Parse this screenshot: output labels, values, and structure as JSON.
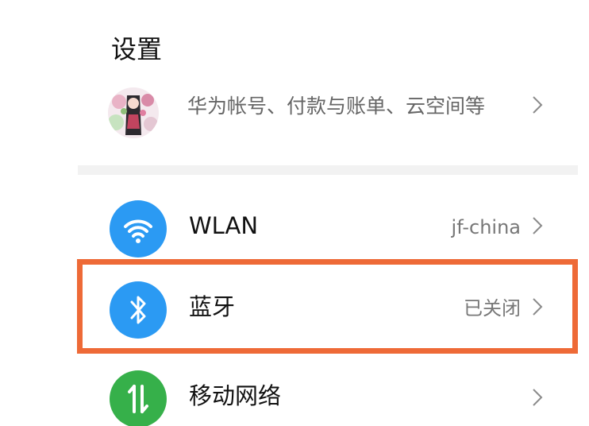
{
  "header": {
    "title": "设置"
  },
  "account": {
    "description": "华为帐号、付款与账单、云空间等",
    "chevron_icon": "chevron-right-icon"
  },
  "settings": {
    "wlan": {
      "label": "WLAN",
      "value": "jf-china",
      "icon": "wifi-icon",
      "icon_color": "#2b9af3"
    },
    "bluetooth": {
      "label": "蓝牙",
      "value": "已关闭",
      "icon": "bluetooth-icon",
      "icon_color": "#2b9af3"
    },
    "mobile_network": {
      "label": "移动网络",
      "value": "",
      "icon": "mobile-data-icon",
      "icon_color": "#36b04a"
    }
  },
  "colors": {
    "highlight": "#ee6a37"
  }
}
